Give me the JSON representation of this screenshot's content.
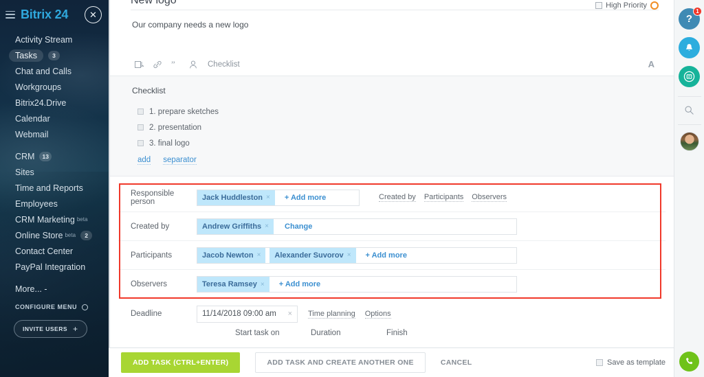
{
  "sidebar": {
    "logo_main": "Bitrix",
    "logo_accent": "24",
    "close_label": "✕",
    "items": [
      {
        "label": "Activity Stream",
        "badge": null,
        "beta": false,
        "active": false
      },
      {
        "label": "Tasks",
        "badge": "3",
        "beta": false,
        "active": true
      },
      {
        "label": "Chat and Calls",
        "badge": null,
        "beta": false,
        "active": false
      },
      {
        "label": "Workgroups",
        "badge": null,
        "beta": false,
        "active": false
      },
      {
        "label": "Bitrix24.Drive",
        "badge": null,
        "beta": false,
        "active": false
      },
      {
        "label": "Calendar",
        "badge": null,
        "beta": false,
        "active": false
      },
      {
        "label": "Webmail",
        "badge": null,
        "beta": false,
        "active": false
      },
      {
        "label": "CRM",
        "badge": "13",
        "beta": false,
        "active": false
      },
      {
        "label": "Sites",
        "badge": null,
        "beta": false,
        "active": false
      },
      {
        "label": "Time and Reports",
        "badge": null,
        "beta": false,
        "active": false
      },
      {
        "label": "Employees",
        "badge": null,
        "beta": false,
        "active": false
      },
      {
        "label": "CRM Marketing",
        "badge": null,
        "beta": true,
        "active": false
      },
      {
        "label": "Online Store",
        "badge": "2",
        "beta": true,
        "active": false
      },
      {
        "label": "Contact Center",
        "badge": null,
        "beta": false,
        "active": false
      },
      {
        "label": "PayPal Integration",
        "badge": null,
        "beta": false,
        "active": false
      },
      {
        "label": "More... -",
        "badge": null,
        "beta": false,
        "active": false
      }
    ],
    "configure_menu": "CONFIGURE MENU",
    "invite_users": "INVITE USERS"
  },
  "task": {
    "title": "New logo",
    "priority_label": "High Priority",
    "description": "Our company needs a new logo",
    "toolbar": {
      "checklist_label": "Checklist",
      "font_label": "A",
      "icons": [
        "attach-file-icon",
        "link-icon",
        "quote-icon",
        "mention-user-icon"
      ]
    },
    "checklist": {
      "heading": "Checklist",
      "items": [
        {
          "text": "1. prepare sketches",
          "checked": false
        },
        {
          "text": "2. presentation",
          "checked": false
        },
        {
          "text": "3. final logo",
          "checked": false
        }
      ],
      "add_label": "add",
      "separator_label": "separator"
    },
    "people": {
      "responsible": {
        "label": "Responsible person",
        "chips": [
          {
            "name": "Jack Huddleston",
            "remove": "×"
          }
        ],
        "add_more": "+ Add more"
      },
      "quick_links": [
        "Created by",
        "Participants",
        "Observers"
      ],
      "created_by": {
        "label": "Created by",
        "chips": [
          {
            "name": "Andrew Griffiths",
            "remove": "×"
          }
        ],
        "change": "Change"
      },
      "participants": {
        "label": "Participants",
        "chips": [
          {
            "name": "Jacob Newton",
            "remove": "×"
          },
          {
            "name": "Alexander Suvorov",
            "remove": "×"
          }
        ],
        "add_more": "+ Add more"
      },
      "observers": {
        "label": "Observers",
        "chips": [
          {
            "name": "Teresa Ramsey",
            "remove": "×"
          }
        ],
        "add_more": "+ Add more"
      }
    },
    "deadline": {
      "label": "Deadline",
      "value": "11/14/2018 09:00 am",
      "clear": "×",
      "links": [
        "Time planning",
        "Options"
      ],
      "sub_headers": [
        "Start task on",
        "Duration",
        "Finish"
      ]
    }
  },
  "footer": {
    "primary": "ADD TASK (CTRL+ENTER)",
    "secondary": "ADD TASK AND CREATE ANOTHER ONE",
    "cancel": "CANCEL",
    "save_as_template": "Save as template"
  },
  "rail": {
    "help_glyph": "?",
    "help_badge": "1",
    "bell_name": "notifications-bell-icon",
    "chat_name": "chat-icon",
    "search_name": "search-icon",
    "avatar_name": "user-avatar",
    "phone_name": "phone-call-icon"
  },
  "colors": {
    "brand_blue": "#2fa8dd",
    "accent_green": "#a8d633",
    "highlight_red": "#f0382a",
    "chip_blue": "#bfe7fb",
    "link_blue": "#3b8fd0"
  }
}
